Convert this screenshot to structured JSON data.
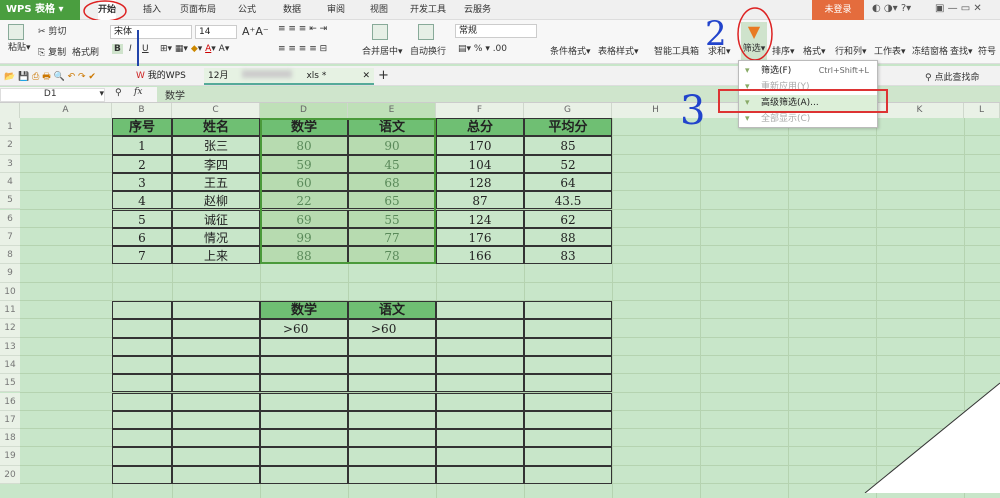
{
  "app": {
    "logo": "WPS 表格",
    "login": "未登录"
  },
  "tabs": [
    "开始",
    "插入",
    "页面布局",
    "公式",
    "数据",
    "审阅",
    "视图",
    "开发工具",
    "云服务"
  ],
  "ribbon": {
    "paste": "粘贴",
    "cut": "剪切",
    "copy": "复制",
    "format_painter": "格式刷",
    "font": "宋体",
    "size": "14",
    "bold": "B",
    "italic": "I",
    "underline": "U",
    "merge": "合并居中",
    "wrap": "自动换行",
    "number_format": "常规",
    "percent": "%",
    "cond_format": "条件格式",
    "table_style": "表格样式",
    "toolbox": "智能工具箱",
    "sum": "求和",
    "filter": "筛选",
    "sort": "排序",
    "format": "格式",
    "rowcol": "行和列",
    "sheet": "工作表",
    "freeze": "冻结窗格",
    "find": "查找",
    "symbol": "符号",
    "search_cmd": "点此查找命"
  },
  "doc_tabs": {
    "mywps": "我的WPS",
    "file": "12月",
    "file_ext": "xls *"
  },
  "formula": {
    "cell_ref": "D1",
    "fx": "fx",
    "value": "数学"
  },
  "columns": [
    "A",
    "B",
    "C",
    "D",
    "E",
    "F",
    "G",
    "H",
    "I",
    "J",
    "K",
    "L"
  ],
  "rows": [
    "1",
    "2",
    "3",
    "4",
    "5",
    "6",
    "7",
    "8",
    "9",
    "10",
    "11",
    "12",
    "13",
    "14",
    "15",
    "16",
    "17",
    "18",
    "19",
    "20"
  ],
  "table": {
    "headers": [
      "序号",
      "姓名",
      "数学",
      "语文",
      "总分",
      "平均分"
    ],
    "data": [
      [
        "1",
        "张三",
        "80",
        "90",
        "170",
        "85"
      ],
      [
        "2",
        "李四",
        "59",
        "45",
        "104",
        "52"
      ],
      [
        "3",
        "王五",
        "60",
        "68",
        "128",
        "64"
      ],
      [
        "4",
        "赵柳",
        "22",
        "65",
        "87",
        "43.5"
      ],
      [
        "5",
        "诚征",
        "69",
        "55",
        "124",
        "62"
      ],
      [
        "6",
        "情况",
        "99",
        "77",
        "176",
        "88"
      ],
      [
        "7",
        "上来",
        "88",
        "78",
        "166",
        "83"
      ]
    ]
  },
  "criteria": {
    "headers": [
      "数学",
      "语文"
    ],
    "values": [
      ">60",
      ">60"
    ]
  },
  "menu": [
    {
      "label": "筛选(F)",
      "shortcut": "Ctrl+Shift+L"
    },
    {
      "label": "重新应用(Y)"
    },
    {
      "label": "高级筛选(A)..."
    },
    {
      "label": "全部显示(C)"
    }
  ],
  "annotations": [
    "2",
    "3"
  ]
}
